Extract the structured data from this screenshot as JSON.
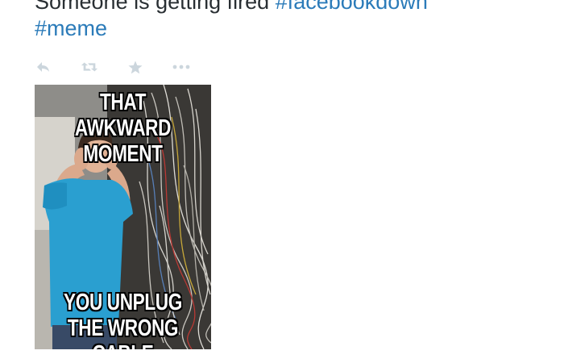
{
  "tweet": {
    "text_prefix": "Someone is getting fired ",
    "hashtags": [
      "#facebookdown",
      "#meme"
    ]
  },
  "actions": {
    "icons": [
      "reply-icon",
      "retweet-icon",
      "favorite-icon",
      "more-icon"
    ],
    "icon_color": "#ccd6dd"
  },
  "meme": {
    "top_caption": "THAT AWKWARD MOMENT",
    "bottom_caption": "YOU UNPLUG THE WRONG CABLE"
  },
  "colors": {
    "text": "#292f33",
    "hashtag": "#2b7bb9",
    "shirt": "#2a9fd0"
  }
}
